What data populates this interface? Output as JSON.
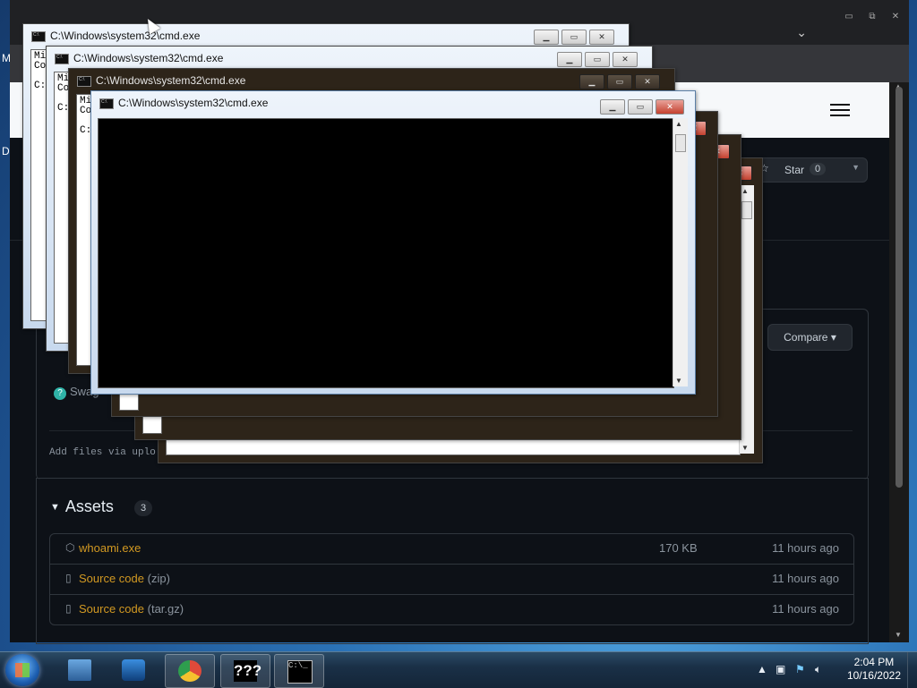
{
  "desktop": {
    "label_m": "M",
    "label_d": "D"
  },
  "github": {
    "star_label": "Star",
    "star_count": "0",
    "compare_label": "Compare",
    "release_author_text": "Swag",
    "add_files_text": "Add files via uplo",
    "assets": {
      "title": "Assets",
      "count": "3",
      "items": [
        {
          "name": "whoami.exe",
          "suffix": "",
          "size": "170 KB",
          "time": "11 hours ago"
        },
        {
          "name": "Source code",
          "suffix": "(zip)",
          "size": "",
          "time": "11 hours ago"
        },
        {
          "name": "Source code",
          "suffix": "(tar.gz)",
          "size": "",
          "time": "11 hours ago"
        }
      ]
    }
  },
  "cmd_windows": {
    "title": "C:\\Windows\\system32\\cmd.exe",
    "text_line1": "Mi",
    "text_line2": "Co",
    "text_line3": "C:"
  },
  "taskbar": {
    "time": "2:04 PM",
    "date": "10/16/2022",
    "unknown_app_label": "???"
  }
}
